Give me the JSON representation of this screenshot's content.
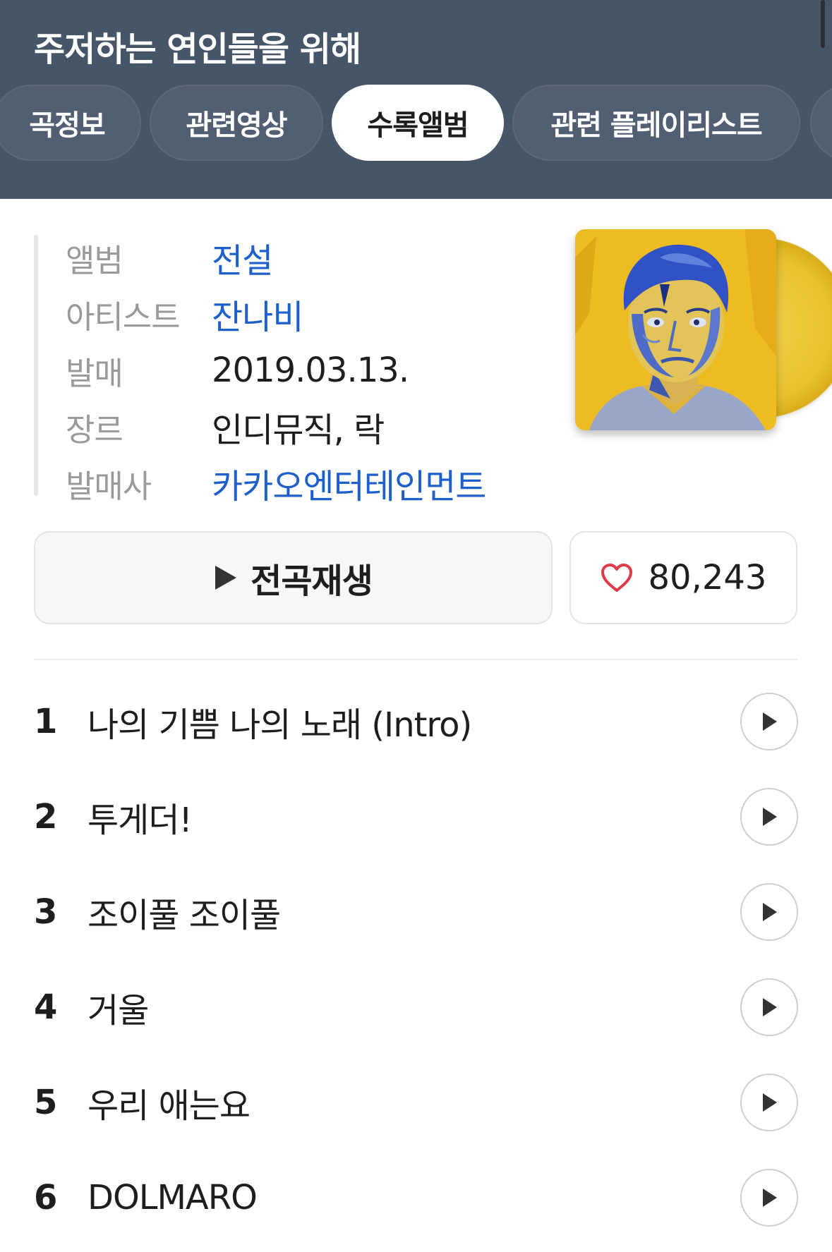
{
  "header": {
    "title": "주저하는 연인들을 위해",
    "tabs": [
      {
        "label": "곡정보",
        "active": false
      },
      {
        "label": "관련영상",
        "active": false
      },
      {
        "label": "수록앨범",
        "active": true
      },
      {
        "label": "관련 플레이리스트",
        "active": false
      }
    ]
  },
  "album": {
    "rows": [
      {
        "label": "앨범",
        "value": "전설",
        "link": true
      },
      {
        "label": "아티스트",
        "value": "잔나비",
        "link": true
      },
      {
        "label": "발매",
        "value": "2019.03.13.",
        "link": false
      },
      {
        "label": "장르",
        "value": "인디뮤직, 락",
        "link": false
      },
      {
        "label": "발매사",
        "value": "카카오엔터테인먼트",
        "link": true
      }
    ],
    "cover_icon": "album-cover-painting"
  },
  "actions": {
    "play_all_label": "전곡재생",
    "like_count": "80,243"
  },
  "tracks": [
    {
      "no": "1",
      "title": "나의 기쁨 나의 노래 (Intro)"
    },
    {
      "no": "2",
      "title": "투게더!"
    },
    {
      "no": "3",
      "title": "조이풀 조이풀"
    },
    {
      "no": "4",
      "title": "거울"
    },
    {
      "no": "5",
      "title": "우리 애는요"
    },
    {
      "no": "6",
      "title": "DOLMARO"
    }
  ],
  "colors": {
    "header_bg": "#475569",
    "link": "#1d5fcc",
    "heart": "#e03a48"
  }
}
